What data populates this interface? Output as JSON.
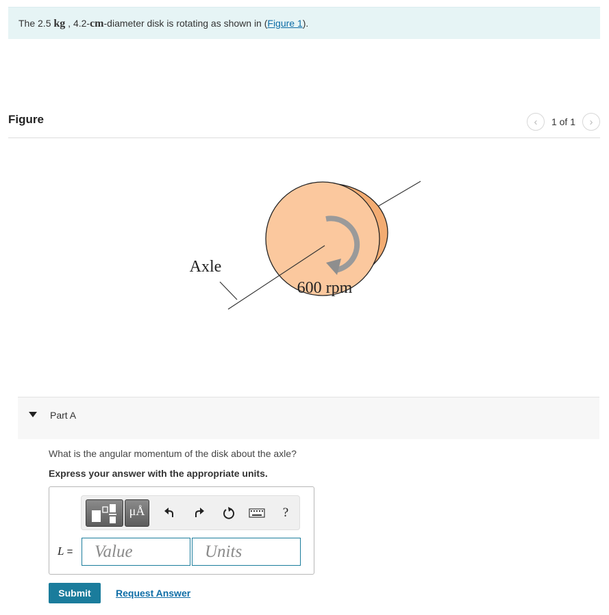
{
  "problem": {
    "prefix": "The 2.5 ",
    "mass_unit": "kg",
    "sep1": " , 4.2-",
    "length_unit": "cm",
    "suffix": "-diameter disk is rotating as shown in (",
    "figure_link": "Figure 1",
    "close": ")."
  },
  "figure": {
    "title": "Figure",
    "pager": "1 of 1",
    "axle_label": "Axle",
    "rpm_label": "600 rpm"
  },
  "part_a": {
    "label": "Part A",
    "question": "What is the angular momentum of the disk about the axle?",
    "instruction": "Express your answer with the appropriate units.",
    "variable": "L",
    "equals": " =",
    "value_placeholder": "Value",
    "units_placeholder": "Units",
    "toolbar": {
      "units_symbol": "μÅ",
      "help_symbol": "?",
      "icons": [
        "templates-icon",
        "units-icon",
        "undo-icon",
        "redo-icon",
        "reset-icon",
        "keyboard-icon",
        "help-icon"
      ]
    },
    "submit_label": "Submit",
    "request_label": "Request Answer"
  },
  "colors": {
    "link": "#0e6da6",
    "accent": "#1a7c9c",
    "problem_bg": "#e6f4f5",
    "disk_fill": "#fbc89e"
  }
}
